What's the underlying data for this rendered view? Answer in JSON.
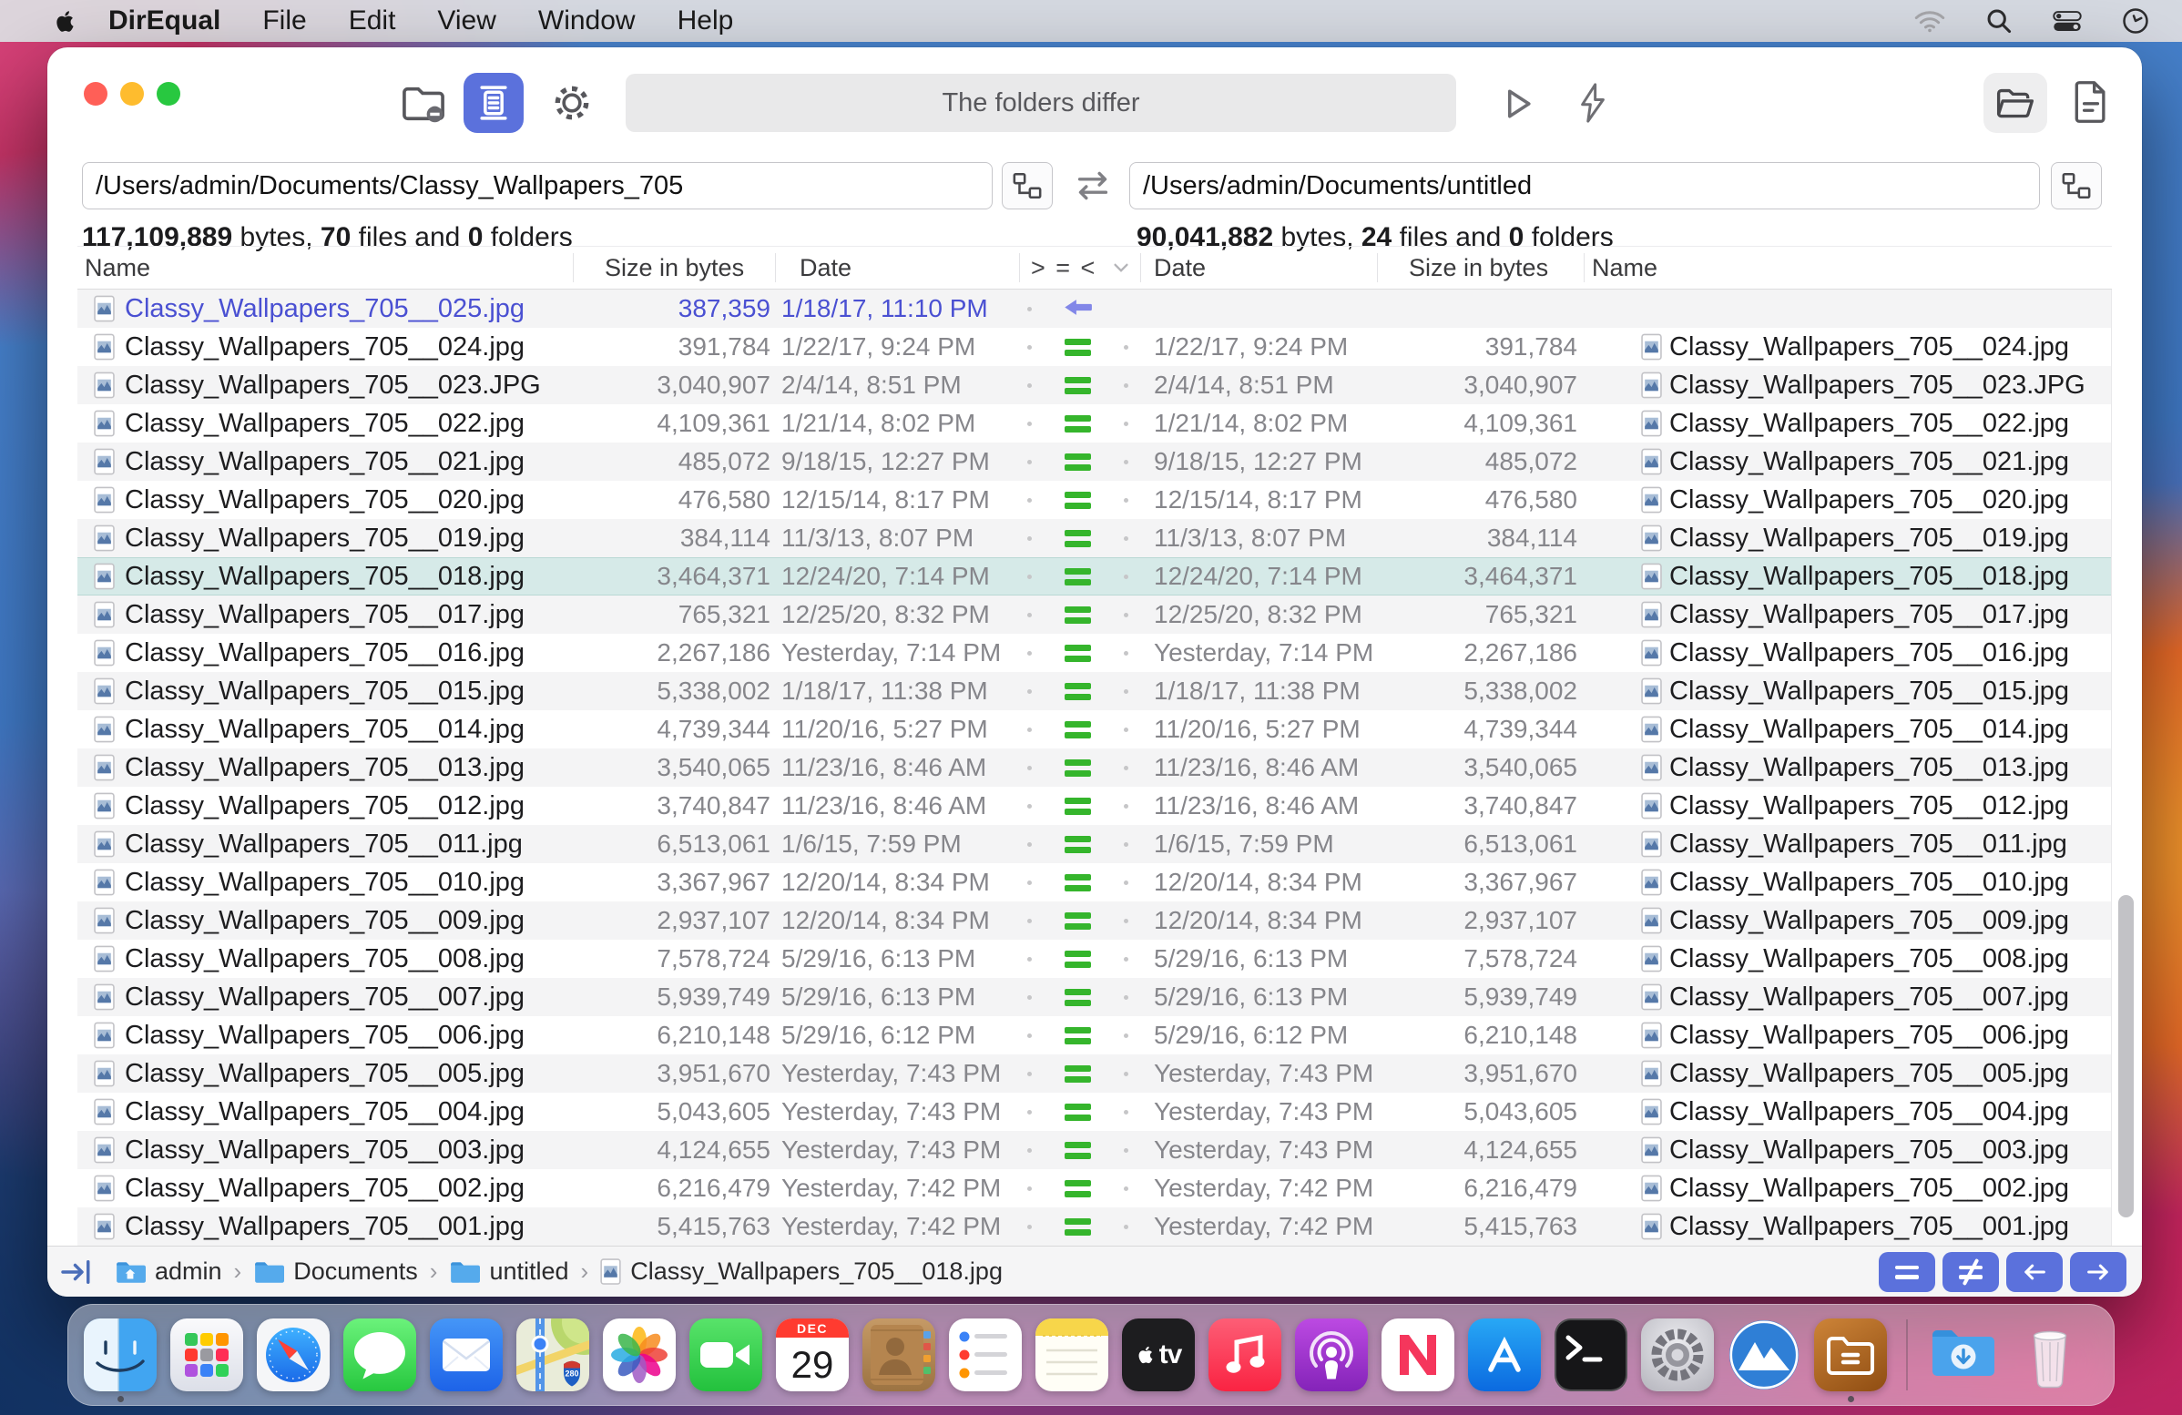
{
  "colors": {
    "accent": "#5b71dc",
    "equal_green": "#35b52c",
    "left_only_blue": "#4a50d2",
    "selection": "#d6eae8",
    "traffic_red": "#ff5f57",
    "traffic_yellow": "#febc2e",
    "traffic_green": "#28c840"
  },
  "menu_bar": {
    "app_name": "DirEqual",
    "menus": [
      "File",
      "Edit",
      "View",
      "Window",
      "Help"
    ]
  },
  "toolbar": {
    "status_text": "The folders differ"
  },
  "panes": {
    "left": {
      "path": "/Users/admin/Documents/Classy_Wallpapers_705",
      "bytes": "117,109,889",
      "bytes_label": " bytes, ",
      "files": "70",
      "files_label": " files and ",
      "folders": "0",
      "folders_label": " folders"
    },
    "right": {
      "path": "/Users/admin/Documents/untitled",
      "bytes": "90,041,882",
      "bytes_label": " bytes, ",
      "files": "24",
      "files_label": " files and ",
      "folders": "0",
      "folders_label": " folders"
    }
  },
  "table": {
    "header": {
      "name_left": "Name",
      "size_left": "Size in bytes",
      "date_left": "Date",
      "compare": "> = <",
      "date_right": "Date",
      "size_right": "Size in bytes",
      "name_right": "Name"
    },
    "rows": [
      {
        "left": {
          "name": "Classy_Wallpapers_705__025.jpg",
          "size": "387,359",
          "date": "1/18/17, 11:10 PM"
        },
        "compare": "left-only",
        "right": null,
        "selected": false
      },
      {
        "left": {
          "name": "Classy_Wallpapers_705__024.jpg",
          "size": "391,784",
          "date": "1/22/17, 9:24 PM"
        },
        "compare": "equal",
        "right": {
          "name": "Classy_Wallpapers_705__024.jpg",
          "size": "391,784",
          "date": "1/22/17, 9:24 PM"
        },
        "selected": false
      },
      {
        "left": {
          "name": "Classy_Wallpapers_705__023.JPG",
          "size": "3,040,907",
          "date": "2/4/14, 8:51 PM"
        },
        "compare": "equal",
        "right": {
          "name": "Classy_Wallpapers_705__023.JPG",
          "size": "3,040,907",
          "date": "2/4/14, 8:51 PM"
        },
        "selected": false
      },
      {
        "left": {
          "name": "Classy_Wallpapers_705__022.jpg",
          "size": "4,109,361",
          "date": "1/21/14, 8:02 PM"
        },
        "compare": "equal",
        "right": {
          "name": "Classy_Wallpapers_705__022.jpg",
          "size": "4,109,361",
          "date": "1/21/14, 8:02 PM"
        },
        "selected": false
      },
      {
        "left": {
          "name": "Classy_Wallpapers_705__021.jpg",
          "size": "485,072",
          "date": "9/18/15, 12:27 PM"
        },
        "compare": "equal",
        "right": {
          "name": "Classy_Wallpapers_705__021.jpg",
          "size": "485,072",
          "date": "9/18/15, 12:27 PM"
        },
        "selected": false
      },
      {
        "left": {
          "name": "Classy_Wallpapers_705__020.jpg",
          "size": "476,580",
          "date": "12/15/14, 8:17 PM"
        },
        "compare": "equal",
        "right": {
          "name": "Classy_Wallpapers_705__020.jpg",
          "size": "476,580",
          "date": "12/15/14, 8:17 PM"
        },
        "selected": false
      },
      {
        "left": {
          "name": "Classy_Wallpapers_705__019.jpg",
          "size": "384,114",
          "date": "11/3/13, 8:07 PM"
        },
        "compare": "equal",
        "right": {
          "name": "Classy_Wallpapers_705__019.jpg",
          "size": "384,114",
          "date": "11/3/13, 8:07 PM"
        },
        "selected": false
      },
      {
        "left": {
          "name": "Classy_Wallpapers_705__018.jpg",
          "size": "3,464,371",
          "date": "12/24/20, 7:14 PM"
        },
        "compare": "equal",
        "right": {
          "name": "Classy_Wallpapers_705__018.jpg",
          "size": "3,464,371",
          "date": "12/24/20, 7:14 PM"
        },
        "selected": true
      },
      {
        "left": {
          "name": "Classy_Wallpapers_705__017.jpg",
          "size": "765,321",
          "date": "12/25/20, 8:32 PM"
        },
        "compare": "equal",
        "right": {
          "name": "Classy_Wallpapers_705__017.jpg",
          "size": "765,321",
          "date": "12/25/20, 8:32 PM"
        },
        "selected": false
      },
      {
        "left": {
          "name": "Classy_Wallpapers_705__016.jpg",
          "size": "2,267,186",
          "date": "Yesterday, 7:14 PM"
        },
        "compare": "equal",
        "right": {
          "name": "Classy_Wallpapers_705__016.jpg",
          "size": "2,267,186",
          "date": "Yesterday, 7:14 PM"
        },
        "selected": false
      },
      {
        "left": {
          "name": "Classy_Wallpapers_705__015.jpg",
          "size": "5,338,002",
          "date": "1/18/17, 11:38 PM"
        },
        "compare": "equal",
        "right": {
          "name": "Classy_Wallpapers_705__015.jpg",
          "size": "5,338,002",
          "date": "1/18/17, 11:38 PM"
        },
        "selected": false
      },
      {
        "left": {
          "name": "Classy_Wallpapers_705__014.jpg",
          "size": "4,739,344",
          "date": "11/20/16, 5:27 PM"
        },
        "compare": "equal",
        "right": {
          "name": "Classy_Wallpapers_705__014.jpg",
          "size": "4,739,344",
          "date": "11/20/16, 5:27 PM"
        },
        "selected": false
      },
      {
        "left": {
          "name": "Classy_Wallpapers_705__013.jpg",
          "size": "3,540,065",
          "date": "11/23/16, 8:46 AM"
        },
        "compare": "equal",
        "right": {
          "name": "Classy_Wallpapers_705__013.jpg",
          "size": "3,540,065",
          "date": "11/23/16, 8:46 AM"
        },
        "selected": false
      },
      {
        "left": {
          "name": "Classy_Wallpapers_705__012.jpg",
          "size": "3,740,847",
          "date": "11/23/16, 8:46 AM"
        },
        "compare": "equal",
        "right": {
          "name": "Classy_Wallpapers_705__012.jpg",
          "size": "3,740,847",
          "date": "11/23/16, 8:46 AM"
        },
        "selected": false
      },
      {
        "left": {
          "name": "Classy_Wallpapers_705__011.jpg",
          "size": "6,513,061",
          "date": "1/6/15, 7:59 PM"
        },
        "compare": "equal",
        "right": {
          "name": "Classy_Wallpapers_705__011.jpg",
          "size": "6,513,061",
          "date": "1/6/15, 7:59 PM"
        },
        "selected": false
      },
      {
        "left": {
          "name": "Classy_Wallpapers_705__010.jpg",
          "size": "3,367,967",
          "date": "12/20/14, 8:34 PM"
        },
        "compare": "equal",
        "right": {
          "name": "Classy_Wallpapers_705__010.jpg",
          "size": "3,367,967",
          "date": "12/20/14, 8:34 PM"
        },
        "selected": false
      },
      {
        "left": {
          "name": "Classy_Wallpapers_705__009.jpg",
          "size": "2,937,107",
          "date": "12/20/14, 8:34 PM"
        },
        "compare": "equal",
        "right": {
          "name": "Classy_Wallpapers_705__009.jpg",
          "size": "2,937,107",
          "date": "12/20/14, 8:34 PM"
        },
        "selected": false
      },
      {
        "left": {
          "name": "Classy_Wallpapers_705__008.jpg",
          "size": "7,578,724",
          "date": "5/29/16, 6:13 PM"
        },
        "compare": "equal",
        "right": {
          "name": "Classy_Wallpapers_705__008.jpg",
          "size": "7,578,724",
          "date": "5/29/16, 6:13 PM"
        },
        "selected": false
      },
      {
        "left": {
          "name": "Classy_Wallpapers_705__007.jpg",
          "size": "5,939,749",
          "date": "5/29/16, 6:13 PM"
        },
        "compare": "equal",
        "right": {
          "name": "Classy_Wallpapers_705__007.jpg",
          "size": "5,939,749",
          "date": "5/29/16, 6:13 PM"
        },
        "selected": false
      },
      {
        "left": {
          "name": "Classy_Wallpapers_705__006.jpg",
          "size": "6,210,148",
          "date": "5/29/16, 6:12 PM"
        },
        "compare": "equal",
        "right": {
          "name": "Classy_Wallpapers_705__006.jpg",
          "size": "6,210,148",
          "date": "5/29/16, 6:12 PM"
        },
        "selected": false
      },
      {
        "left": {
          "name": "Classy_Wallpapers_705__005.jpg",
          "size": "3,951,670",
          "date": "Yesterday, 7:43 PM"
        },
        "compare": "equal",
        "right": {
          "name": "Classy_Wallpapers_705__005.jpg",
          "size": "3,951,670",
          "date": "Yesterday, 7:43 PM"
        },
        "selected": false
      },
      {
        "left": {
          "name": "Classy_Wallpapers_705__004.jpg",
          "size": "5,043,605",
          "date": "Yesterday, 7:43 PM"
        },
        "compare": "equal",
        "right": {
          "name": "Classy_Wallpapers_705__004.jpg",
          "size": "5,043,605",
          "date": "Yesterday, 7:43 PM"
        },
        "selected": false
      },
      {
        "left": {
          "name": "Classy_Wallpapers_705__003.jpg",
          "size": "4,124,655",
          "date": "Yesterday, 7:43 PM"
        },
        "compare": "equal",
        "right": {
          "name": "Classy_Wallpapers_705__003.jpg",
          "size": "4,124,655",
          "date": "Yesterday, 7:43 PM"
        },
        "selected": false
      },
      {
        "left": {
          "name": "Classy_Wallpapers_705__002.jpg",
          "size": "6,216,479",
          "date": "Yesterday, 7:42 PM"
        },
        "compare": "equal",
        "right": {
          "name": "Classy_Wallpapers_705__002.jpg",
          "size": "6,216,479",
          "date": "Yesterday, 7:42 PM"
        },
        "selected": false
      },
      {
        "left": {
          "name": "Classy_Wallpapers_705__001.jpg",
          "size": "5,415,763",
          "date": "Yesterday, 7:42 PM"
        },
        "compare": "equal",
        "right": {
          "name": "Classy_Wallpapers_705__001.jpg",
          "size": "5,415,763",
          "date": "Yesterday, 7:42 PM"
        },
        "selected": false
      }
    ]
  },
  "status_bar": {
    "breadcrumb": [
      {
        "label": "admin"
      },
      {
        "label": "Documents"
      },
      {
        "label": "untitled"
      },
      {
        "label": "Classy_Wallpapers_705__018.jpg"
      }
    ]
  },
  "dock": {
    "calendar": {
      "month": "DEC",
      "day": "29"
    },
    "appletv_label": "tv",
    "items": [
      "finder",
      "launchpad",
      "safari",
      "messages",
      "mail",
      "maps",
      "photos",
      "facetime",
      "calendar",
      "contacts",
      "reminders",
      "notes",
      "apple-tv",
      "music",
      "podcasts",
      "news",
      "app-store",
      "terminal",
      "system-preferences",
      "mountain-app",
      "direqual",
      "separator",
      "downloads",
      "trash"
    ]
  }
}
